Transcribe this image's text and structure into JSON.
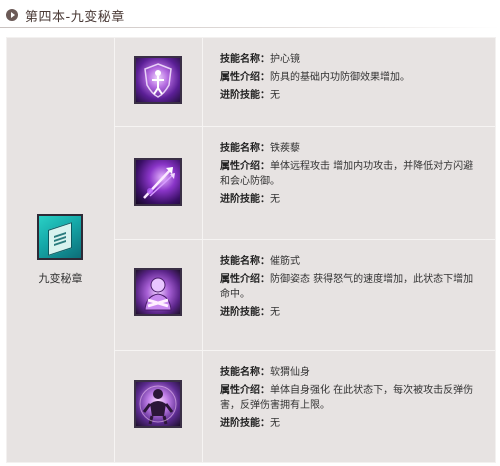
{
  "header": {
    "title": "第四本-九变秘章"
  },
  "book": {
    "label": "九变秘章",
    "icon": "teal-book-icon"
  },
  "labels": {
    "name": "技能名称：",
    "desc": "属性介绍：",
    "advance": "进阶技能："
  },
  "skills": [
    {
      "name": "护心镜",
      "desc": "防具的基础内功防御效果增加。",
      "advance": "无",
      "icon": "guardian-shield-icon"
    },
    {
      "name": "铁蒺藜",
      "desc": "单体远程攻击 增加内功攻击，并降低对方闪避和会心防御。",
      "advance": "无",
      "icon": "spiked-darts-icon"
    },
    {
      "name": "催筋式",
      "desc": "防御姿态 获得怒气的速度增加，此状态下增加命中。",
      "advance": "无",
      "icon": "crossed-arms-monk-icon"
    },
    {
      "name": "软猬仙身",
      "desc": "单体自身强化 在此状态下，每次被攻击反弹伤害，反弹伤害拥有上限。",
      "advance": "无",
      "icon": "aura-body-icon"
    }
  ]
}
